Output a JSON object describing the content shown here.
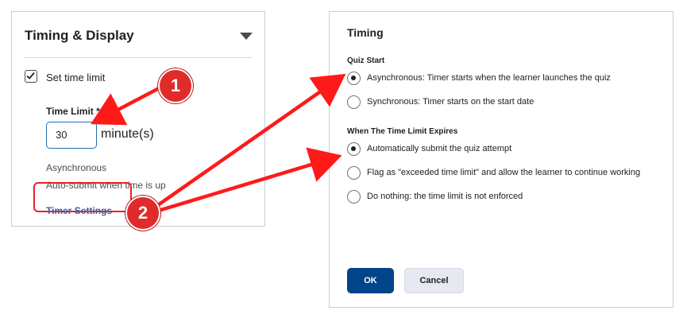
{
  "left_panel": {
    "title": "Timing & Display",
    "set_time_limit_label": "Set time limit",
    "set_time_limit_checked": true,
    "time_limit_label": "Time Limit *",
    "time_limit_value": "30",
    "time_limit_unit": "minute(s)",
    "mode_text": "Asynchronous",
    "expiry_text": "Auto-submit when time is up",
    "timer_settings_link": "Timer Settings"
  },
  "dialog": {
    "title": "Timing",
    "quiz_start": {
      "label": "Quiz Start",
      "options": [
        {
          "label": "Asynchronous: Timer starts when the learner launches the quiz",
          "selected": true
        },
        {
          "label": "Synchronous: Timer starts on the start date",
          "selected": false
        }
      ]
    },
    "expiry": {
      "label": "When The Time Limit Expires",
      "options": [
        {
          "label": "Automatically submit the quiz attempt",
          "selected": true
        },
        {
          "label": "Flag as \"exceeded time limit\" and allow the learner to continue working",
          "selected": false
        },
        {
          "label": "Do nothing: the time limit is not enforced",
          "selected": false
        }
      ]
    },
    "ok_label": "OK",
    "cancel_label": "Cancel"
  },
  "annotations": {
    "badge_1": "1",
    "badge_2": "2"
  },
  "colors": {
    "accent": "#1e6fb5",
    "primary_button": "#004489",
    "annotation_red": "#e02b2b"
  }
}
